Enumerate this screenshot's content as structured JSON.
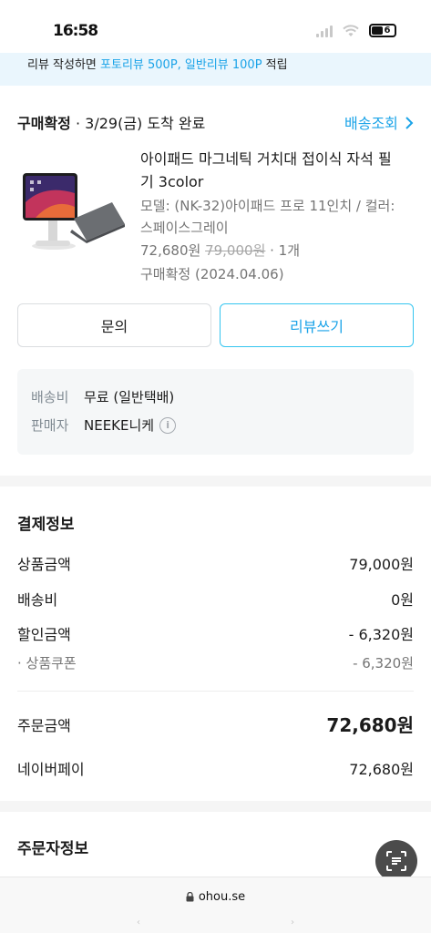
{
  "status_bar": {
    "time": "16:58",
    "battery": "6"
  },
  "banner": {
    "prefix": "리뷰 작성하면 ",
    "accent": "포토리뷰 500P, 일반리뷰 100P",
    "suffix": " 적립"
  },
  "order": {
    "status_label": "구매확정",
    "status_detail": " · 3/29(금) 도착 완료",
    "track_link": "배송조회"
  },
  "product": {
    "title": "아이패드 마그네틱 거치대 접이식 자석 필기 3color",
    "option": "모델: (NK-32)아이패드 프로 11인치 / 컬러: 스페이스그레이",
    "price": "72,680원",
    "original_price": "79,000원",
    "quantity": " · 1개",
    "confirmed": "구매확정 (2024.04.06)"
  },
  "buttons": {
    "inquiry": "문의",
    "review": "리뷰쓰기"
  },
  "delivery_info": {
    "shipping_label": "배송비",
    "shipping_value": "무료 (일반택배)",
    "seller_label": "판매자",
    "seller_value": "NEEKE니케"
  },
  "payment": {
    "title": "결제정보",
    "rows": [
      {
        "label": "상품금액",
        "value": "79,000원"
      },
      {
        "label": "배송비",
        "value": "0원"
      },
      {
        "label": "할인금액",
        "value": "- 6,320원"
      },
      {
        "label": "· 상품쿠폰",
        "value": "- 6,320원"
      }
    ],
    "total_label": "주문금액",
    "total_value": "72,680원",
    "method_label": "네이버페이",
    "method_value": "72,680원"
  },
  "orderer": {
    "title": "주문자정보"
  },
  "browser": {
    "url": "ohou.se"
  },
  "colors": {
    "accent": "#1aa3e8",
    "banner_bg": "#eaf6fd",
    "info_bg": "#f5f7f8"
  }
}
